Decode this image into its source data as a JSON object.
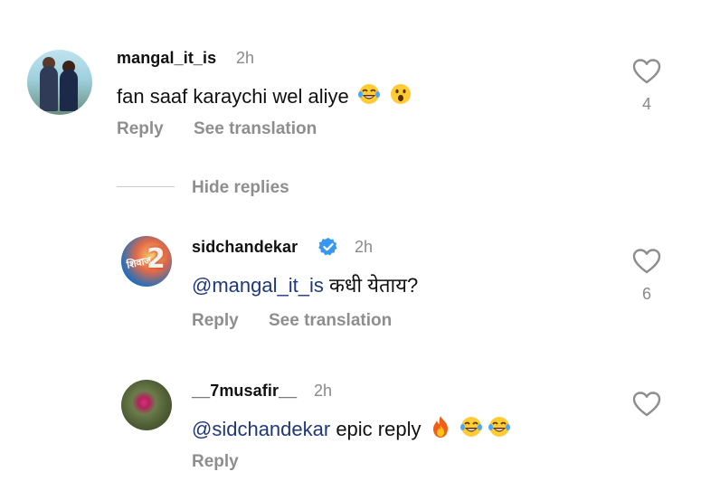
{
  "comments": [
    {
      "username": "mangal_it_is",
      "time": "2h",
      "text": "fan saaf karaychi wel aliye",
      "emojis": [
        "laughing-tears-emoji",
        "surprised-face-emoji"
      ],
      "reply_label": "Reply",
      "translate_label": "See translation",
      "likes": "4"
    },
    {
      "username": "sidchandekar",
      "verified": true,
      "time": "2h",
      "mention": "@mangal_it_is",
      "text": " कधी येताय?",
      "reply_label": "Reply",
      "translate_label": "See translation",
      "likes": "6"
    },
    {
      "username": "__7musafir__",
      "time": "2h",
      "mention": "@sidchandekar",
      "text": " epic reply",
      "emojis": [
        "fire-emoji",
        "laughing-tears-emoji",
        "laughing-tears-emoji"
      ],
      "reply_label": "Reply"
    }
  ],
  "hide_replies_label": "Hide replies",
  "colors": {
    "mention": "#20387a",
    "muted": "#8e8e8e",
    "verified": "#3897f0"
  }
}
